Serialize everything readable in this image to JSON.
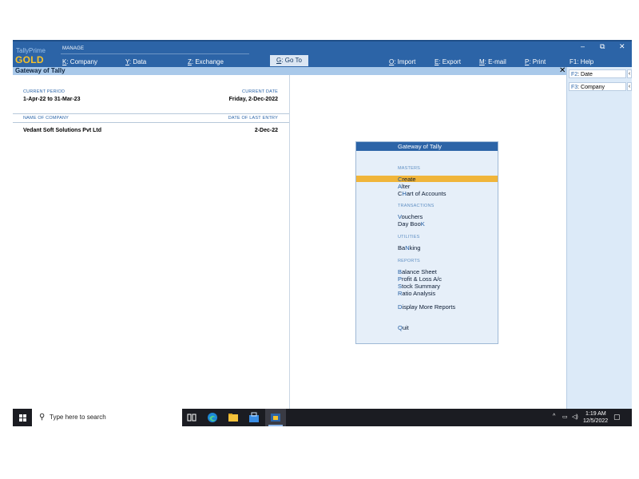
{
  "brand": {
    "small": "TallyPrime",
    "big": "GOLD"
  },
  "header": {
    "manage": "MANAGE",
    "menu": [
      {
        "key": "K",
        "rest": ": Company"
      },
      {
        "key": "Y",
        "rest": ": Data"
      },
      {
        "key": "Z",
        "rest": ": Exchange"
      },
      {
        "key": "G",
        "rest": ": Go To"
      },
      {
        "key": "O",
        "rest": ": Import"
      },
      {
        "key": "E",
        "rest": ": Export"
      },
      {
        "key": "M",
        "rest": ": E-mail"
      },
      {
        "key": "P",
        "rest": ": Print"
      },
      {
        "key": "F1",
        "rest": ": Help"
      }
    ],
    "window_controls": {
      "minimize": "–",
      "restore": "⧉",
      "close": "✕"
    }
  },
  "titlebar": {
    "title": "Gateway of Tally",
    "close": "✕"
  },
  "left": {
    "current_period_label": "CURRENT PERIOD",
    "current_period": "1-Apr-22 to 31-Mar-23",
    "current_date_label": "CURRENT DATE",
    "current_date": "Friday, 2-Dec-2022",
    "company_col_label": "NAME OF COMPANY",
    "last_entry_col_label": "DATE OF LAST ENTRY",
    "companies": [
      {
        "name": "Vedant Soft Solutions Pvt Ltd",
        "last_entry": "2-Dec-22"
      }
    ]
  },
  "right_panel": {
    "buttons": [
      {
        "key": "F2",
        "rest": ": Date"
      },
      {
        "key": "F3",
        "rest": ": Company"
      }
    ],
    "arrow": "‹"
  },
  "gateway": {
    "title": "Gateway of Tally",
    "sections": {
      "masters": "MASTERS",
      "transactions": "TRANSACTIONS",
      "utilities": "UTILITIES",
      "reports": "REPORTS"
    },
    "items": {
      "create": {
        "pre": "",
        "hk": "C",
        "post": "reate"
      },
      "alter": {
        "pre": "",
        "hk": "A",
        "post": "lter"
      },
      "chart_of_accounts": {
        "pre": "C",
        "hk": "H",
        "post": "art of Accounts"
      },
      "vouchers": {
        "pre": "",
        "hk": "V",
        "post": "ouchers"
      },
      "day_book": {
        "pre": "Day Boo",
        "hk": "K",
        "post": ""
      },
      "banking": {
        "pre": "Ba",
        "hk": "N",
        "post": "king"
      },
      "balance_sheet": {
        "pre": "",
        "hk": "B",
        "post": "alance Sheet"
      },
      "profit_loss": {
        "pre": "",
        "hk": "P",
        "post": "rofit & Loss A/c"
      },
      "stock_summary": {
        "pre": "",
        "hk": "S",
        "post": "tock Summary"
      },
      "ratio_analysis": {
        "pre": "",
        "hk": "R",
        "post": "atio Analysis"
      },
      "display_more": {
        "pre": "",
        "hk": "D",
        "post": "isplay More Reports"
      },
      "quit": {
        "pre": "",
        "hk": "Q",
        "post": "uit"
      }
    },
    "selected": "create",
    "highlight_color": "#f0b53a",
    "accent_color": "#2c64a7"
  },
  "taskbar": {
    "search_placeholder": "Type here to search",
    "time": "1:19 AM",
    "date": "12/5/2022",
    "icons": [
      "windows-icon",
      "search-icon",
      "task-view-icon",
      "edge-icon",
      "file-explorer-icon",
      "store-icon",
      "tally-icon",
      "chevron-up-icon",
      "network-icon",
      "volume-icon",
      "notification-icon"
    ]
  }
}
